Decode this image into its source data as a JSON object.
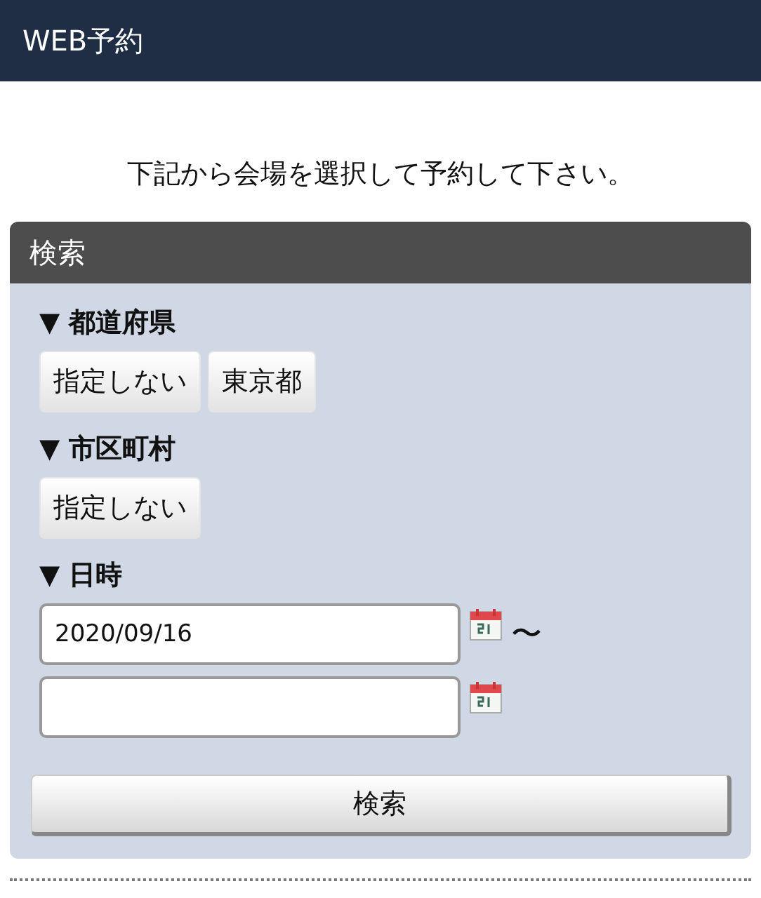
{
  "header": {
    "title": "WEB予約"
  },
  "intro": "下記から会場を選択して予約して下さい。",
  "panel": {
    "title": "検索",
    "sections": [
      {
        "kind": "choices",
        "label": "▼ 都道府県",
        "options": [
          "指定しない",
          "東京都"
        ]
      },
      {
        "kind": "choices",
        "label": "▼ 市区町村",
        "options": [
          "指定しない"
        ]
      },
      {
        "kind": "dates",
        "label": "▼ 日時",
        "from": "2020/09/16",
        "separator": "〜"
      }
    ],
    "submit": "検索"
  }
}
